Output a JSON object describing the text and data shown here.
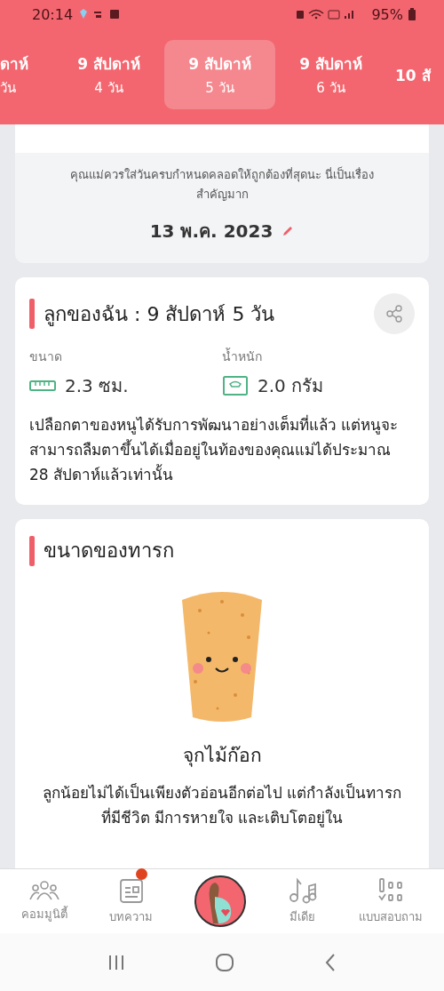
{
  "status_bar": {
    "time": "20:14",
    "battery": "95%"
  },
  "week_tabs": [
    {
      "line1": "ดาห์",
      "line2": "วัน",
      "selected": false
    },
    {
      "line1": "9 สัปดาห์",
      "line2": "4 วัน",
      "selected": false
    },
    {
      "line1": "9 สัปดาห์",
      "line2": "5 วัน",
      "selected": true
    },
    {
      "line1": "9 สัปดาห์",
      "line2": "6 วัน",
      "selected": false
    },
    {
      "line1": "10 สั",
      "selected": false
    }
  ],
  "due_date_card": {
    "note": "คุณแม่ควรใส่วันครบกำหนดคลอดให้ถูกต้องที่สุดนะ นี่เป็นเรื่องสำคัญมาก",
    "date": "13 พ.ค. 2023"
  },
  "baby_card": {
    "title": "ลูกของฉัน : 9 สัปดาห์ 5  วัน",
    "stats": [
      {
        "kind": "size",
        "label": "ขนาด",
        "value": "2.3 ซม."
      },
      {
        "kind": "weight",
        "label": "น้ำหนัก",
        "value": "2.0 กรัม"
      }
    ],
    "description": "เปลือกตาของหนูได้รับการพัฒนาอย่างเต็มที่แล้ว แต่หนูจะสามารถลืมตาขึ้นได้เมื่ออยู่ในท้องของคุณแม่ได้ประมาณ 28 สัปดาห์แล้วเท่านั้น"
  },
  "size_card": {
    "title": "ขนาดของทารก",
    "object_name": "จุกไม้ก๊อก",
    "description": "ลูกน้อยไม่ได้เป็นเพียงตัวอ่อนอีกต่อไป แต่กำลังเป็นทารกที่มีชีวิต มีการหายใจ และเติบโตอยู่ใน"
  },
  "bottom_nav": [
    {
      "kind": "community",
      "label": "คอมมูนิตี้",
      "badge": false
    },
    {
      "kind": "articles",
      "label": "บทความ",
      "badge": true
    },
    {
      "kind": "home"
    },
    {
      "kind": "media",
      "label": "มีเดีย",
      "badge": false
    },
    {
      "kind": "quiz",
      "label": "แบบสอบถาม",
      "badge": false
    }
  ]
}
